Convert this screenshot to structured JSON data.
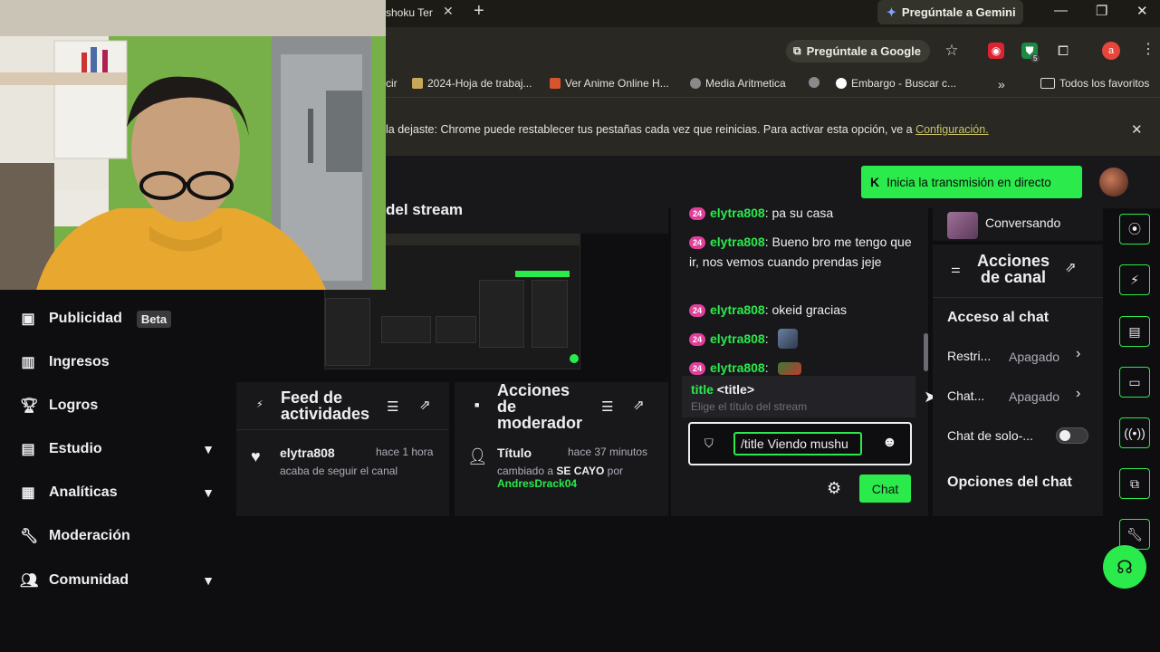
{
  "browser": {
    "tab_title": "shoku Ter",
    "gemini_button": "Pregúntale a Gemini",
    "ask_google": "Pregúntale a Google",
    "account_initial": "a",
    "extension_badge": "5"
  },
  "bookmarks": {
    "items": [
      "cir",
      "2024-Hoja de trabaj...",
      "Ver Anime Online H...",
      "Media Aritmetica",
      "Embargo - Buscar c..."
    ],
    "more": "»",
    "all_bookmarks": "Todos los favoritos"
  },
  "infobar": {
    "text": "la dejaste: Chrome puede restablecer tus pestañas cada vez que reinicias. Para activar esta opción, ve a",
    "link": "Configuración."
  },
  "twitch": {
    "go_live": "Inicia la transmisión en directo"
  },
  "sidebar": {
    "items": [
      {
        "label": "Publicidad",
        "badge": "Beta"
      },
      {
        "label": "Ingresos"
      },
      {
        "label": "Logros"
      },
      {
        "label": "Estudio"
      },
      {
        "label": "Analíticas"
      },
      {
        "label": "Moderación"
      },
      {
        "label": "Comunidad"
      }
    ]
  },
  "preview": {
    "title": "del stream"
  },
  "activity_feed": {
    "title_line1": "Feed de",
    "title_line2": "actividades",
    "user": "elytra808",
    "time": "hace 1 hora",
    "desc": "acaba de seguir el canal"
  },
  "mod_actions": {
    "title_line1": "Acciones",
    "title_line2": "de",
    "title_line3": "moderador",
    "action": "Título",
    "time": "hace 37 minutos",
    "desc_prefix": "cambiado a",
    "new_title": "SE CAYO",
    "desc_by": "por",
    "moderator": "AndresDrack04"
  },
  "chat": {
    "badge": "24",
    "messages": [
      {
        "user": "elytra808",
        "text": ": pa su casa"
      },
      {
        "user": "elytra808",
        "text": ": Bueno bro me tengo que ir, nos vemos cuando prendas jeje"
      },
      {
        "user": "elytra808",
        "text": ": okeid gracias"
      },
      {
        "user": "elytra808",
        "text": ":"
      },
      {
        "user": "elytra808",
        "text": ":"
      }
    ],
    "suggestion_cmd": "title",
    "suggestion_arg": "<title>",
    "suggestion_desc": "Elige el título del stream",
    "input_value": "/title Viendo mushu",
    "send_label": "Chat"
  },
  "channel_actions": {
    "status": "Conversando",
    "title_line1": "Acciones",
    "title_line2": "de canal",
    "section_access": "Acceso al chat",
    "rows": [
      {
        "label": "Restri...",
        "value": "Apagado"
      },
      {
        "label": "Chat...",
        "value": "Apagado"
      },
      {
        "label": "Chat de solo-..."
      }
    ],
    "section_options": "Opciones del chat"
  }
}
